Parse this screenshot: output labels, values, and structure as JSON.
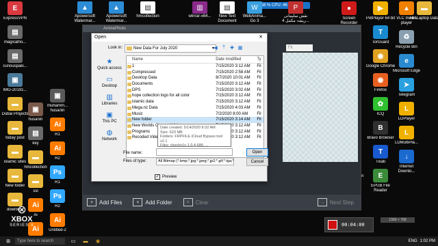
{
  "desktop": {
    "left_col1": [
      {
        "label": "ExpressVPN",
        "icon": "shield-icon",
        "color": "#da3940",
        "glyph": "E"
      },
      {
        "label": "magicalho...",
        "icon": "file-icon",
        "color": "#6a6a6a",
        "glyph": "▤"
      },
      {
        "label": "curiouspaki...",
        "icon": "file-icon",
        "color": "#6a6a6a",
        "glyph": "▤"
      },
      {
        "label": "IMG-20191...",
        "icon": "image-icon",
        "color": "#4a7a9a",
        "glyph": "▣"
      },
      {
        "label": "Dubai Projects",
        "icon": "folder-icon",
        "color": "#e8b83c",
        "glyph": "▬"
      },
      {
        "label": "today post",
        "icon": "folder-icon",
        "color": "#e8b83c",
        "glyph": "▬"
      },
      {
        "label": "islamic sites",
        "icon": "folder-icon",
        "color": "#e8b83c",
        "glyph": "▬"
      },
      {
        "label": "New folder",
        "icon": "folder-icon",
        "color": "#e8b83c",
        "glyph": "▬"
      },
      {
        "label": "downlo...",
        "icon": "folder-icon",
        "color": "#e8b83c",
        "glyph": "▬"
      }
    ],
    "left_col2": [
      {
        "label": "husanin",
        "icon": "image-icon",
        "color": "#7a5a4a",
        "glyph": "▣"
      },
      {
        "label": "key",
        "icon": "file-icon",
        "color": "#6a6a6a",
        "glyph": "▤"
      },
      {
        "label": "hmcollection",
        "icon": "folder-icon",
        "color": "#e8b83c",
        "glyph": "▬"
      },
      {
        "label": "ssl",
        "icon": "folder-icon",
        "color": "#e8b83c",
        "glyph": "▬"
      },
      {
        "label": "Ai",
        "icon": "illustrator-icon",
        "color": "#ff7c00",
        "glyph": "Ai"
      },
      {
        "label": "Untitled-1",
        "icon": "illustrator-icon",
        "color": "#ff7c00",
        "glyph": "Ai"
      }
    ],
    "left_col3": [
      {
        "label": "muhamm... husanin",
        "icon": "image-icon",
        "color": "#5a5a5a",
        "glyph": "▣"
      },
      {
        "label": "R1",
        "icon": "illustrator-icon",
        "color": "#ff7c00",
        "glyph": "Ai"
      },
      {
        "label": "R2",
        "icon": "illustrator-icon",
        "color": "#ff7c00",
        "glyph": "Ai"
      },
      {
        "label": "R1",
        "icon": "photoshop-icon",
        "color": "#31a8ff",
        "glyph": "Ps"
      },
      {
        "label": "R2",
        "icon": "photoshop-icon",
        "color": "#31a8ff",
        "glyph": "Ps"
      },
      {
        "label": "Untitled-2",
        "icon": "illustrator-icon",
        "color": "#ff7c00",
        "glyph": "Ai"
      }
    ],
    "top_row": [
      {
        "label": "Apowersoft Watermar...",
        "icon": "apowersoft-icon",
        "color": "#2d8cd6",
        "glyph": "▲"
      },
      {
        "label": "Apowersoft Watermar...",
        "icon": "apowersoft-icon",
        "color": "#2d8cd6",
        "glyph": "▲"
      },
      {
        "label": "hmcollection",
        "icon": "file-icon",
        "color": "#ffffff",
        "glyph": "▤"
      },
      {
        "label": "winrar-x64...",
        "icon": "winrar-icon",
        "color": "#8a2a8a",
        "glyph": "▥"
      },
      {
        "label": "New Text Document",
        "icon": "text-file-icon",
        "color": "#ffffff",
        "glyph": "▤"
      },
      {
        "label": "WebAnima... Go 3",
        "icon": "app-icon",
        "color": "#3aa0e0",
        "glyph": "W"
      },
      {
        "label": "نقش سلیمانی ریشہ مکمل 4...",
        "icon": "pdf-icon",
        "color": "#c03030",
        "glyph": "P"
      }
    ],
    "right_col1": [
      {
        "label": "Screen Recorder",
        "icon": "screen-recorder-icon",
        "color": "#d01a1a",
        "glyph": "●"
      },
      {
        "label": "Boxcryptor",
        "icon": "boxcryptor-icon",
        "color": "#1a6ad0",
        "glyph": "■"
      },
      {
        "label": "Wondershare Filmora9",
        "icon": "filmora-icon",
        "color": "#1ad0b0",
        "glyph": "F"
      },
      {
        "label": "Advanced SystemCare",
        "icon": "systemcare-icon",
        "color": "#1a5ad0",
        "glyph": "A"
      },
      {
        "label": "NordVPN",
        "icon": "nordvpn-icon",
        "color": "#2a5ab0",
        "glyph": "N"
      },
      {
        "label": "MEGAsync",
        "icon": "mega-icon",
        "color": "#d01a1a",
        "glyph": "M"
      },
      {
        "label": "Vidmore Screen R...",
        "icon": "vidmore-icon",
        "color": "#2a6ad0",
        "glyph": "V"
      },
      {
        "label": "Mozilla Thunderbird",
        "icon": "thunderbird-icon",
        "color": "#2a7ad0",
        "glyph": "T"
      }
    ],
    "right_col2": [
      {
        "label": "PotPlayer 64 bit",
        "icon": "potplayer-icon",
        "color": "#f0b000",
        "glyph": "▶"
      },
      {
        "label": "TorGuard",
        "icon": "torguard-icon",
        "color": "#1a8ad0",
        "glyph": "T"
      },
      {
        "label": "Google Chrome",
        "icon": "chrome-icon",
        "color": "#e0a020",
        "glyph": "◉"
      },
      {
        "label": "Firefox",
        "icon": "firefox-icon",
        "color": "#e86020",
        "glyph": "◉"
      },
      {
        "label": "ICQ",
        "icon": "icq-icon",
        "color": "#30c030",
        "glyph": "✿"
      },
      {
        "label": "Bravo Browser",
        "icon": "bravo-icon",
        "color": "#303030",
        "glyph": "B"
      },
      {
        "label": "Tixati",
        "icon": "tixati-icon",
        "color": "#1a5ad0",
        "glyph": "T"
      },
      {
        "label": "EPUB File Reader",
        "icon": "epub-icon",
        "color": "#3a8a3a",
        "glyph": "E"
      }
    ],
    "right_col3": [
      {
        "label": "VLC media player",
        "icon": "vlc-icon",
        "color": "#f08000",
        "glyph": "▲"
      },
      {
        "label": "Recycle Bin",
        "icon": "recycle-bin-icon",
        "color": "#8aa0b0",
        "glyph": "♻"
      },
      {
        "label": "Microsoft Edge",
        "icon": "edge-icon",
        "color": "#2a8ad0",
        "glyph": "e"
      },
      {
        "label": "Telegram",
        "icon": "telegram-icon",
        "color": "#2aa0e0",
        "glyph": "➤"
      },
      {
        "label": "LDPlayer",
        "icon": "ldplayer-icon",
        "color": "#f0b000",
        "glyph": "L"
      },
      {
        "label": "LDMultiPla...",
        "icon": "ldmultiplayer-icon",
        "color": "#f0b000",
        "glyph": "L"
      },
      {
        "label": "Internet Downlo...",
        "icon": "idm-icon",
        "color": "#1a6ad0",
        "glyph": "↓"
      }
    ],
    "right_col4": [
      {
        "label": "HP Laptop Data",
        "icon": "folder-icon",
        "color": "#e8b83c",
        "glyph": "▬"
      }
    ]
  },
  "indicator": {
    "text": "RAM: 58 %  CPU: 46 %"
  },
  "app": {
    "title": "AnimePhoto",
    "fit_placeholder": "Fit",
    "add_files": "Add Files",
    "add_folder": "Add Folder",
    "clear": "Clear",
    "next_step": "Next Step"
  },
  "dialog": {
    "title": "Open",
    "look_in_label": "Look in:",
    "look_in_value": "New Data For July 2020",
    "places": [
      {
        "label": "Quick access",
        "icon": "star-icon",
        "glyph": "★"
      },
      {
        "label": "Desktop",
        "icon": "desktop-icon",
        "glyph": "▭"
      },
      {
        "label": "Libraries",
        "icon": "libraries-icon",
        "glyph": "▥"
      },
      {
        "label": "This PC",
        "icon": "computer-icon",
        "glyph": "▣"
      },
      {
        "label": "Network",
        "icon": "network-icon",
        "glyph": "◍"
      }
    ],
    "columns": {
      "name": "Name",
      "date": "Date modified",
      "type": "Ty"
    },
    "rows": [
      {
        "name": "1",
        "date": "7/15/2020 3:12 AM",
        "type": "Fil"
      },
      {
        "name": "Compressed",
        "date": "7/15/2020 2:58 AM",
        "type": "Fil"
      },
      {
        "name": "Desktop Data",
        "date": "8/7/2020 10:01 AM",
        "type": "Fil"
      },
      {
        "name": "Documents",
        "date": "7/15/2020 3:12 AM",
        "type": "Fil"
      },
      {
        "name": "DPS",
        "date": "7/15/2020 3:02 AM",
        "type": "Fil"
      },
      {
        "name": "hope collection logo for all color",
        "date": "7/15/2020 3:12 AM",
        "type": "Fil"
      },
      {
        "name": "islamic data",
        "date": "7/15/2020 3:12 AM",
        "type": "Fil"
      },
      {
        "name": "Mega.nz Data",
        "date": "7/15/2020 4:03 AM",
        "type": "Fil"
      },
      {
        "name": "Music",
        "date": "7/2/2020 8:00 AM",
        "type": "Fil"
      },
      {
        "name": "New folder",
        "date": "7/15/2020 3:14 AM",
        "type": "Fil"
      },
      {
        "name": "New Worlds Channel Videos",
        "date": "7/15/2020 3:12 AM",
        "type": "Fil"
      },
      {
        "name": "Programs",
        "date": "7/15/2020 3:12 AM",
        "type": "Fil"
      },
      {
        "name": "Recoded Video",
        "date": "7/15/2020 3:12 AM",
        "type": "Fil"
      }
    ],
    "selected_row": "New folder",
    "tooltip": [
      "Date created: 5/14/2020 8:32 AM",
      "Size: 623 MB",
      "Folders: FRPFILE iCloud Bypass tool v2.1",
      "Files: checkn1x-1.0.4-686, ..."
    ],
    "file_name_label": "File name:",
    "file_name_value": "",
    "files_of_type_label": "Files of type:",
    "files_of_type_value": "All Bitmap (*.bmp;*.jpg;*.jpeg;*.jp2;*.gif;*.tga;*.pr",
    "open_button": "Open",
    "cancel_button": "Cancel",
    "preview_label": "Preview",
    "preview_checked": true
  },
  "xbox": {
    "line1": "XBOX",
    "line2": "SERIES X"
  },
  "recorder": {
    "time": "00:04:00"
  },
  "recorder_badge": "1366 × 768",
  "taskbar": {
    "search_placeholder": "Type here to search",
    "lang": "ENG",
    "time": "1:02 PM"
  }
}
